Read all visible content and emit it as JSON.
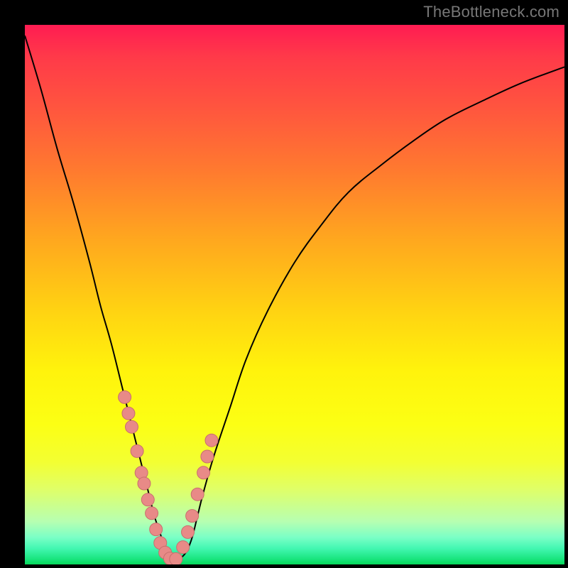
{
  "watermark": "TheBottleneck.com",
  "colors": {
    "gradient_top": "#ff1c52",
    "gradient_mid": "#fff30c",
    "gradient_bottom": "#06d75a",
    "curve": "#000000",
    "marker_fill": "#e88a87",
    "marker_stroke": "#c86f6d"
  },
  "chart_data": {
    "type": "line",
    "title": "",
    "xlabel": "",
    "ylabel": "",
    "xlim": [
      0,
      100
    ],
    "ylim": [
      0,
      100
    ],
    "x": [
      0,
      3,
      6,
      9,
      12,
      14,
      16,
      18,
      20,
      21,
      22,
      23,
      24,
      25,
      26,
      27,
      28,
      29,
      30,
      31,
      32,
      33,
      35,
      38,
      41,
      45,
      50,
      55,
      60,
      66,
      72,
      78,
      85,
      92,
      100
    ],
    "values": [
      98,
      88,
      77,
      67,
      56,
      48,
      41,
      33,
      25,
      21,
      17,
      13,
      9,
      6,
      3,
      1.5,
      1,
      1.3,
      2.5,
      5,
      9,
      13,
      20,
      29,
      38,
      47,
      56,
      63,
      69,
      74,
      78.5,
      82.5,
      86,
      89.2,
      92.2
    ],
    "markers": {
      "x": [
        18.5,
        19.2,
        19.8,
        20.8,
        21.6,
        22.1,
        22.8,
        23.5,
        24.3,
        25.1,
        26.0,
        26.9,
        28.0,
        29.3,
        30.2,
        31.0,
        32.0,
        33.1,
        33.8,
        34.6
      ],
      "values": [
        31,
        28,
        25.5,
        21,
        17,
        15,
        12,
        9.5,
        6.5,
        4,
        2.2,
        1.1,
        1.0,
        3.2,
        6.0,
        9.0,
        13.0,
        17.0,
        20.0,
        23.0
      ]
    }
  }
}
